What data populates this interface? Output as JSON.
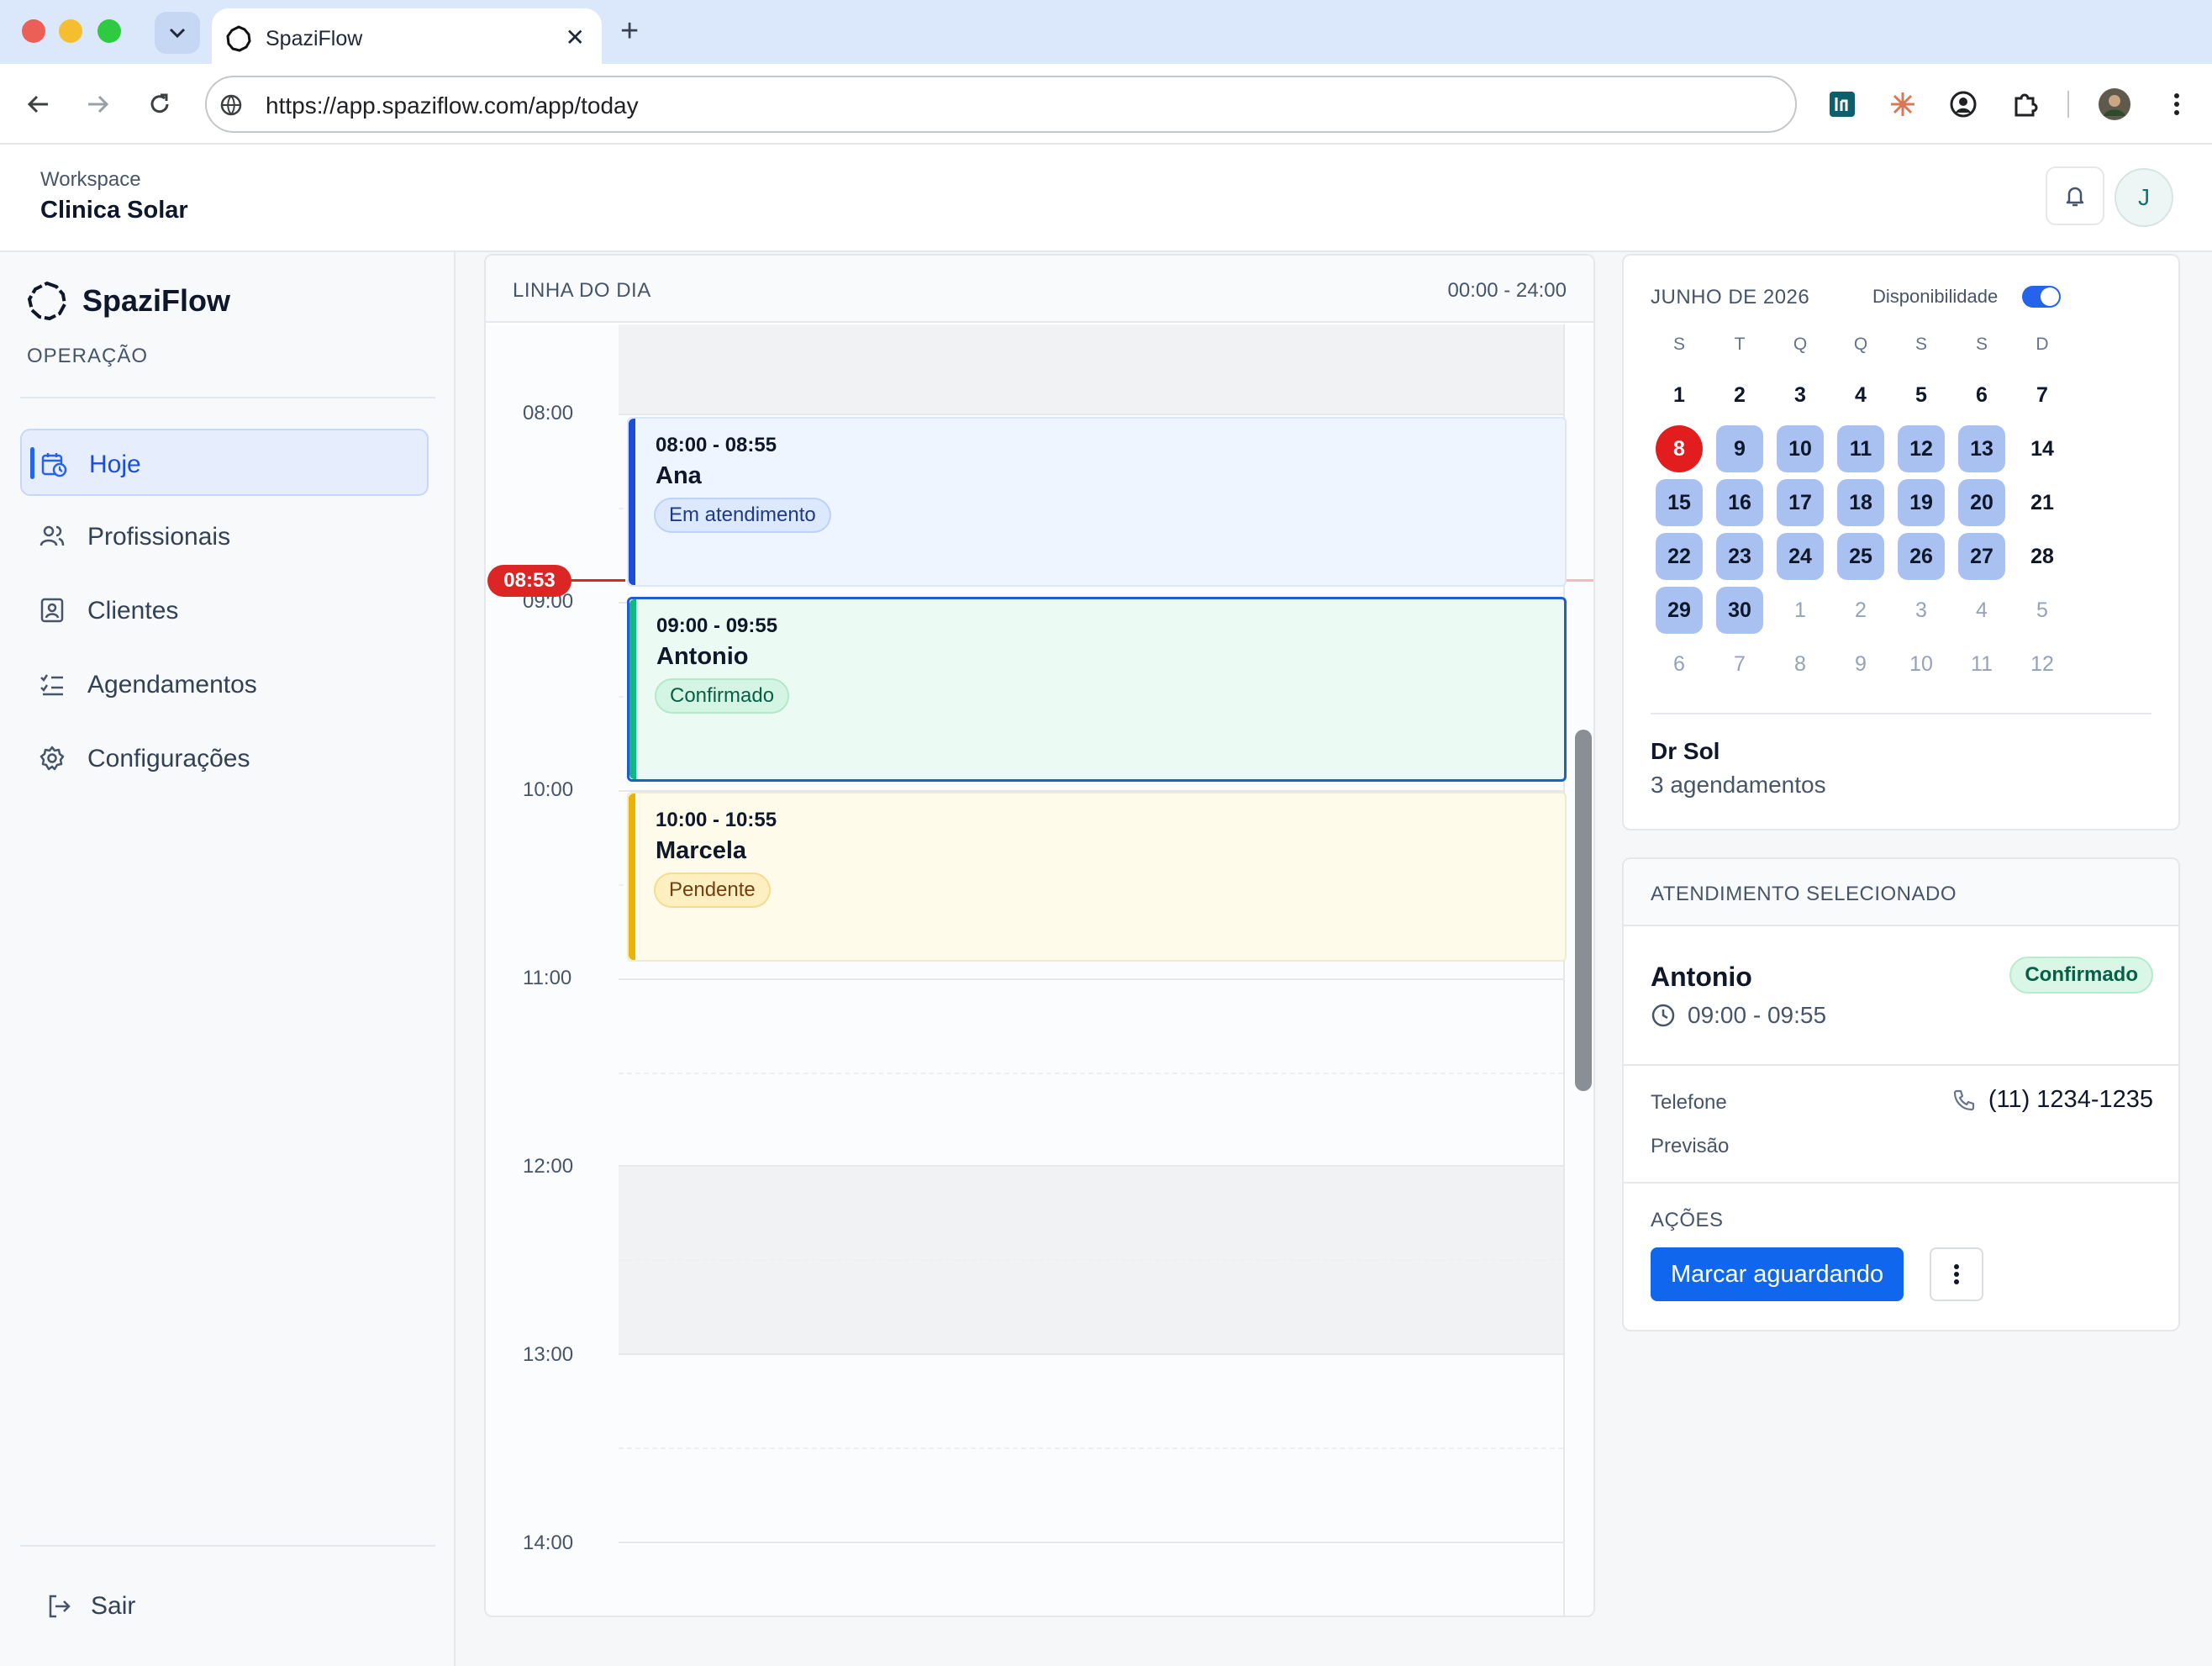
{
  "browser": {
    "tab_title": "SpaziFlow",
    "url": "https://app.spaziflow.com/app/today"
  },
  "header": {
    "workspace_label": "Workspace",
    "workspace_name": "Clinica Solar",
    "avatar_initial": "J"
  },
  "sidebar": {
    "brand": "SpaziFlow",
    "section": "OPERAÇÃO",
    "items": [
      {
        "label": "Hoje",
        "icon": "calendar-clock-icon",
        "active": true
      },
      {
        "label": "Profissionais",
        "icon": "users-icon",
        "active": false
      },
      {
        "label": "Clientes",
        "icon": "contact-card-icon",
        "active": false
      },
      {
        "label": "Agendamentos",
        "icon": "list-checks-icon",
        "active": false
      },
      {
        "label": "Configurações",
        "icon": "gear-icon",
        "active": false
      }
    ],
    "logout": "Sair"
  },
  "timeline": {
    "title": "LINHA DO DIA",
    "range": "00:00 - 24:00",
    "hours": [
      "08:00",
      "09:00",
      "10:00",
      "11:00",
      "12:00",
      "13:00",
      "14:00"
    ],
    "now": "08:53",
    "events": [
      {
        "time": "08:00 - 08:55",
        "name": "Ana",
        "status": "Em atendimento",
        "color": "#1d4ed8"
      },
      {
        "time": "09:00 - 09:55",
        "name": "Antonio",
        "status": "Confirmado",
        "color": "#10b981"
      },
      {
        "time": "10:00 - 10:55",
        "name": "Marcela",
        "status": "Pendente",
        "color": "#eab308"
      }
    ]
  },
  "calendar": {
    "month": "JUNHO DE 2026",
    "availability_label": "Disponibilidade",
    "availability_on": true,
    "weekdays": [
      "S",
      "T",
      "Q",
      "Q",
      "S",
      "S",
      "D"
    ],
    "weeks": [
      [
        "1",
        "2",
        "3",
        "4",
        "5",
        "6",
        "7"
      ],
      [
        "8",
        "9",
        "10",
        "11",
        "12",
        "13",
        "14"
      ],
      [
        "15",
        "16",
        "17",
        "18",
        "19",
        "20",
        "21"
      ],
      [
        "22",
        "23",
        "24",
        "25",
        "26",
        "27",
        "28"
      ],
      [
        "29",
        "30",
        "1",
        "2",
        "3",
        "4",
        "5"
      ],
      [
        "6",
        "7",
        "8",
        "9",
        "10",
        "11",
        "12"
      ]
    ],
    "today": "8",
    "professional": "Dr Sol",
    "appointments": "3 agendamentos"
  },
  "selected": {
    "title": "ATENDIMENTO SELECIONADO",
    "name": "Antonio",
    "status": "Confirmado",
    "time": "09:00 - 09:55",
    "phone_label": "Telefone",
    "phone": "(11) 1234-1235",
    "forecast_label": "Previsão",
    "actions_label": "AÇÕES",
    "primary_action": "Marcar aguardando"
  }
}
